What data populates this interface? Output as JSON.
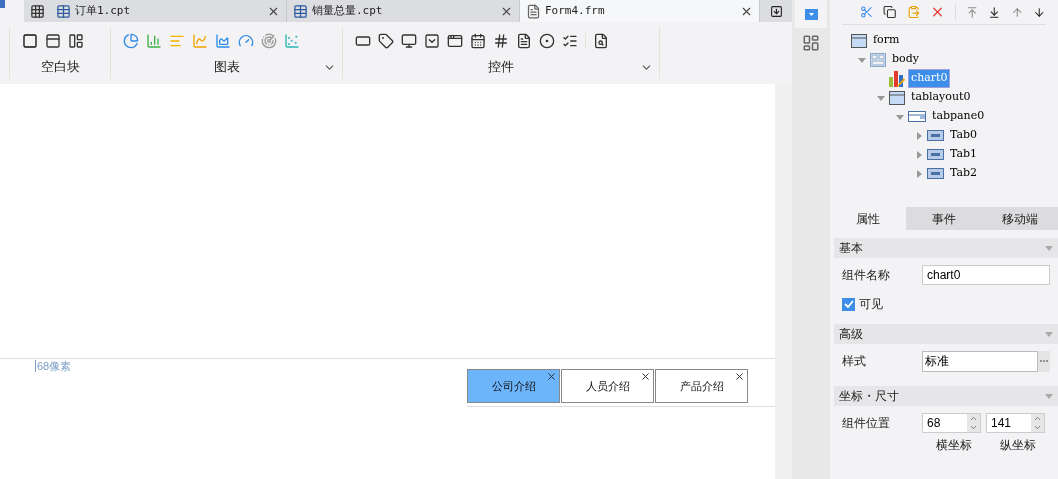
{
  "doc_tabs": [
    {
      "label": "订单1.cpt",
      "selected": false
    },
    {
      "label": "销量总量.cpt",
      "selected": false
    },
    {
      "label": "Form4.frm",
      "selected": true
    }
  ],
  "toolbar_groups": [
    {
      "label": "空白块",
      "menu": false
    },
    {
      "label": "图表",
      "menu": true
    },
    {
      "label": "控件",
      "menu": true
    }
  ],
  "canvas": {
    "ruler_label": "68像素",
    "tabs": [
      {
        "label": "公司介绍",
        "selected": true
      },
      {
        "label": "人员介绍",
        "selected": false
      },
      {
        "label": "产品介绍",
        "selected": false
      }
    ]
  },
  "tree": [
    {
      "label": "form",
      "kind": "form",
      "selected": false,
      "children": [
        {
          "label": "body",
          "kind": "body",
          "expanded": true,
          "selected": false,
          "children": [
            {
              "label": "chart0",
              "kind": "chart",
              "selected": true
            },
            {
              "label": "tablayout0",
              "kind": "form",
              "expanded": true,
              "selected": false,
              "children": [
                {
                  "label": "tabpane0",
                  "kind": "tabpane",
                  "expanded": true,
                  "selected": false,
                  "children": [
                    {
                      "label": "Tab0",
                      "kind": "tab",
                      "expanded": false,
                      "selected": false
                    },
                    {
                      "label": "Tab1",
                      "kind": "tab",
                      "expanded": false,
                      "selected": false
                    },
                    {
                      "label": "Tab2",
                      "kind": "tab",
                      "expanded": false,
                      "selected": false
                    }
                  ]
                }
              ]
            }
          ]
        }
      ]
    }
  ],
  "prop_tabs": [
    {
      "label": "属性",
      "selected": true
    },
    {
      "label": "事件",
      "selected": false
    },
    {
      "label": "移动端",
      "selected": false
    }
  ],
  "sections": [
    {
      "title": "基本",
      "rows": [
        {
          "kind": "text",
          "label": "组件名称",
          "value": "chart0"
        },
        {
          "kind": "checkbox",
          "label": "可见",
          "checked": true
        }
      ]
    },
    {
      "title": "高级",
      "rows": [
        {
          "kind": "style",
          "label": "样式",
          "value": "标准"
        }
      ]
    },
    {
      "title": "坐标・尺寸",
      "rows": [
        {
          "kind": "spinners",
          "label": "组件位置",
          "values": [
            "68",
            "141"
          ],
          "captions": [
            "横坐标",
            "纵坐标"
          ]
        }
      ]
    }
  ]
}
